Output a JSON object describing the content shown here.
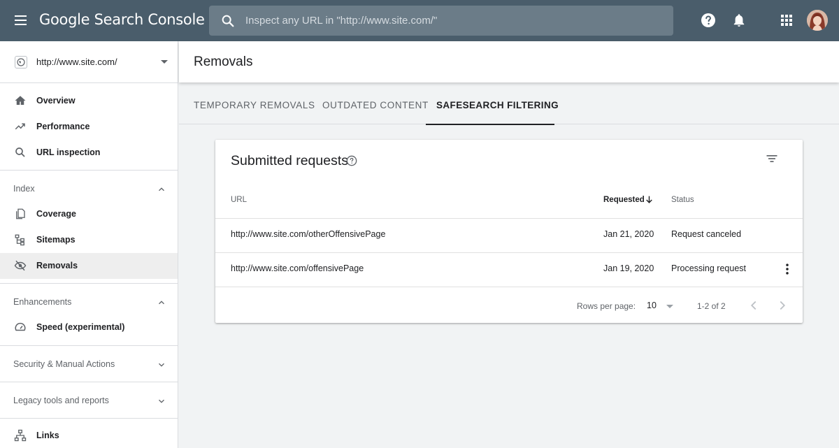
{
  "app": {
    "logo_text": "Google Search Console"
  },
  "search": {
    "placeholder": "Inspect any URL in \"http://www.site.com/\""
  },
  "property": {
    "label": "http://www.site.com/"
  },
  "sidebar": {
    "top_items": [
      {
        "label": "Overview",
        "icon": "home-icon"
      },
      {
        "label": "Performance",
        "icon": "trending-up-icon"
      },
      {
        "label": "URL inspection",
        "icon": "search-icon"
      }
    ],
    "index_section": {
      "label": "Index",
      "items": [
        {
          "label": "Coverage",
          "icon": "copy-icon"
        },
        {
          "label": "Sitemaps",
          "icon": "sitemap-icon"
        },
        {
          "label": "Removals",
          "icon": "visibility-off-icon",
          "active": true
        }
      ]
    },
    "enhancements_section": {
      "label": "Enhancements",
      "items": [
        {
          "label": "Speed (experimental)",
          "icon": "speedometer-icon"
        }
      ]
    },
    "security_section": {
      "label": "Security & Manual Actions"
    },
    "legacy_section": {
      "label": "Legacy tools and reports"
    },
    "links_item": {
      "label": "Links",
      "icon": "links-icon"
    }
  },
  "page": {
    "title": "Removals"
  },
  "tabs": [
    {
      "label": "TEMPORARY REMOVALS",
      "active": false
    },
    {
      "label": "OUTDATED CONTENT",
      "active": false
    },
    {
      "label": "SAFESEARCH FILTERING",
      "active": true
    }
  ],
  "card": {
    "title": "Submitted requests",
    "columns": {
      "url": "URL",
      "requested": "Requested",
      "status": "Status"
    },
    "rows": [
      {
        "url": "http://www.site.com/otherOffensivePage",
        "requested": "Jan 21, 2020",
        "status": "Request canceled"
      },
      {
        "url": "http://www.site.com/offensivePage",
        "requested": "Jan 19, 2020",
        "status": "Processing request"
      }
    ],
    "pagination": {
      "rows_per_page_label": "Rows per page:",
      "rows_per_page_value": "10",
      "range": "1-2 of 2"
    }
  },
  "colors": {
    "topbar": "#4a5d6b",
    "search_bg": "#6b7c88",
    "active_nav_bg": "#eeeeee"
  }
}
